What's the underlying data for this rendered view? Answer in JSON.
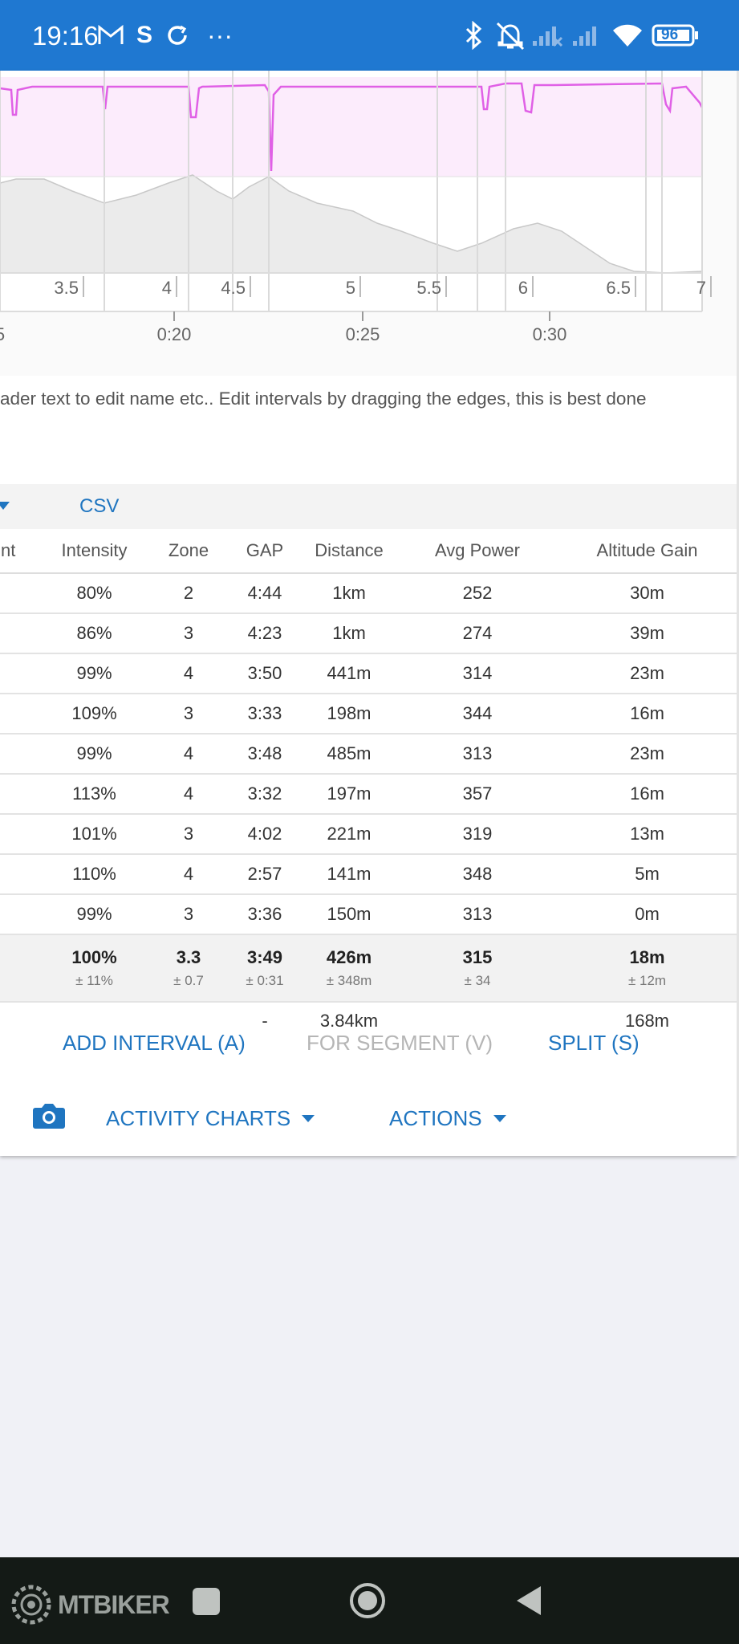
{
  "status_bar": {
    "time": "19:16",
    "notification_letter": "S",
    "more": "···",
    "battery": "96"
  },
  "chart": {
    "distance_ticks": [
      "3.5",
      "4",
      "4.5",
      "5",
      "5.5",
      "6",
      "6.5",
      "7"
    ],
    "time_ticks": [
      "5",
      "0:20",
      "0:25",
      "0:30"
    ],
    "power_color": "#e060e6",
    "power_fill": "#fcecfc",
    "altitude_fill": "#ebebeb"
  },
  "hint_text": "ader text to edit name etc.. Edit intervals by dragging the edges, this is best done",
  "toolbar": {
    "csv_label": "CSV"
  },
  "table": {
    "headers": [
      "nt",
      "Intensity",
      "Zone",
      "GAP",
      "Distance",
      "Avg Power",
      "Altitude Gain"
    ],
    "rows": [
      [
        "80%",
        "2",
        "4:44",
        "1km",
        "252",
        "30m"
      ],
      [
        "86%",
        "3",
        "4:23",
        "1km",
        "274",
        "39m"
      ],
      [
        "99%",
        "4",
        "3:50",
        "441m",
        "314",
        "23m"
      ],
      [
        "109%",
        "3",
        "3:33",
        "198m",
        "344",
        "16m"
      ],
      [
        "99%",
        "4",
        "3:48",
        "485m",
        "313",
        "23m"
      ],
      [
        "113%",
        "4",
        "3:32",
        "197m",
        "357",
        "16m"
      ],
      [
        "101%",
        "3",
        "4:02",
        "221m",
        "319",
        "13m"
      ],
      [
        "110%",
        "4",
        "2:57",
        "141m",
        "348",
        "5m"
      ],
      [
        "99%",
        "3",
        "3:36",
        "150m",
        "313",
        "0m"
      ]
    ],
    "summary": {
      "intensity": "100%",
      "intensity_sd": "± 11%",
      "zone": "3.3",
      "zone_sd": "± 0.7",
      "gap": "3:49",
      "gap_sd": "± 0:31",
      "distance": "426m",
      "distance_sd": "± 348m",
      "power": "315",
      "power_sd": "± 34",
      "altitude": "18m",
      "altitude_sd": "± 12m"
    },
    "totals": {
      "gap": "-",
      "distance": "3.84km",
      "altitude": "168m"
    }
  },
  "buttons": {
    "add_interval": "ADD INTERVAL (A)",
    "for_segment": "FOR SEGMENT (V)",
    "split": "SPLIT (S)",
    "activity_charts": "ACTIVITY CHARTS",
    "actions": "ACTIONS"
  },
  "watermark": "MTBIKER"
}
